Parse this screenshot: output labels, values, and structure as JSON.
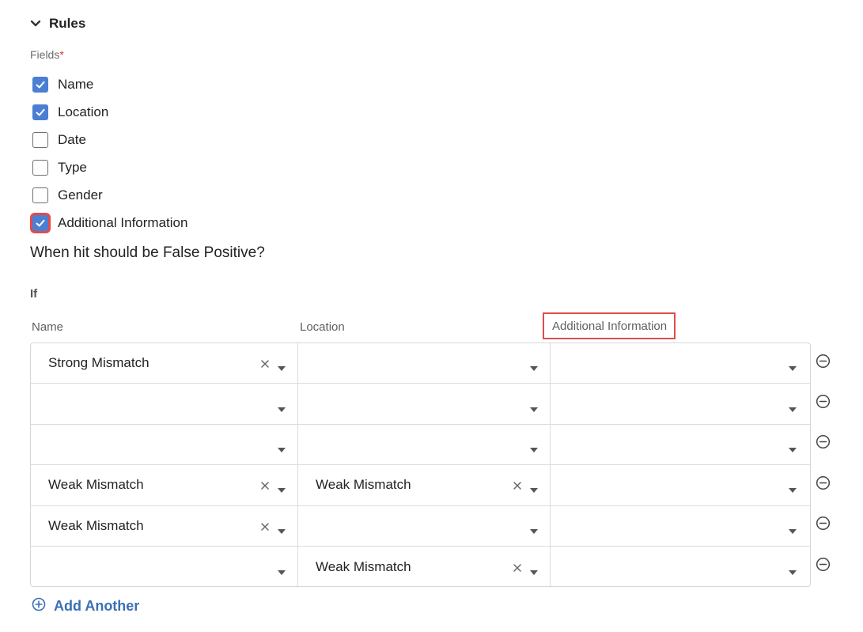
{
  "section": {
    "title": "Rules",
    "expand_icon": "chevron-down-icon"
  },
  "fields": {
    "label": "Fields",
    "required_mark": "*",
    "options": [
      {
        "label": "Name",
        "checked": true
      },
      {
        "label": "Location",
        "checked": true
      },
      {
        "label": "Date",
        "checked": false
      },
      {
        "label": "Type",
        "checked": false
      },
      {
        "label": "Gender",
        "checked": false
      },
      {
        "label": "Additional Information",
        "checked": true
      }
    ]
  },
  "question": "When hit should be False Positive?",
  "condition_label": "If",
  "columns": [
    "Name",
    "Location",
    "Additional Information"
  ],
  "rows": [
    {
      "name": "Strong Mismatch",
      "location": "",
      "additional_information": ""
    },
    {
      "name": "",
      "location": "",
      "additional_information": ""
    },
    {
      "name": "",
      "location": "",
      "additional_information": ""
    },
    {
      "name": "Weak Mismatch",
      "location": "Weak Mismatch",
      "additional_information": ""
    },
    {
      "name": "Weak Mismatch",
      "location": "",
      "additional_information": ""
    },
    {
      "name": "",
      "location": "Weak Mismatch",
      "additional_information": ""
    }
  ],
  "add_another": {
    "label": "Add Another",
    "icon": "plus-circle-icon"
  },
  "colors": {
    "accent": "#4a7fd4",
    "highlight": "#e24b4b",
    "link": "#3a6fb5",
    "required": "#d9342b"
  }
}
